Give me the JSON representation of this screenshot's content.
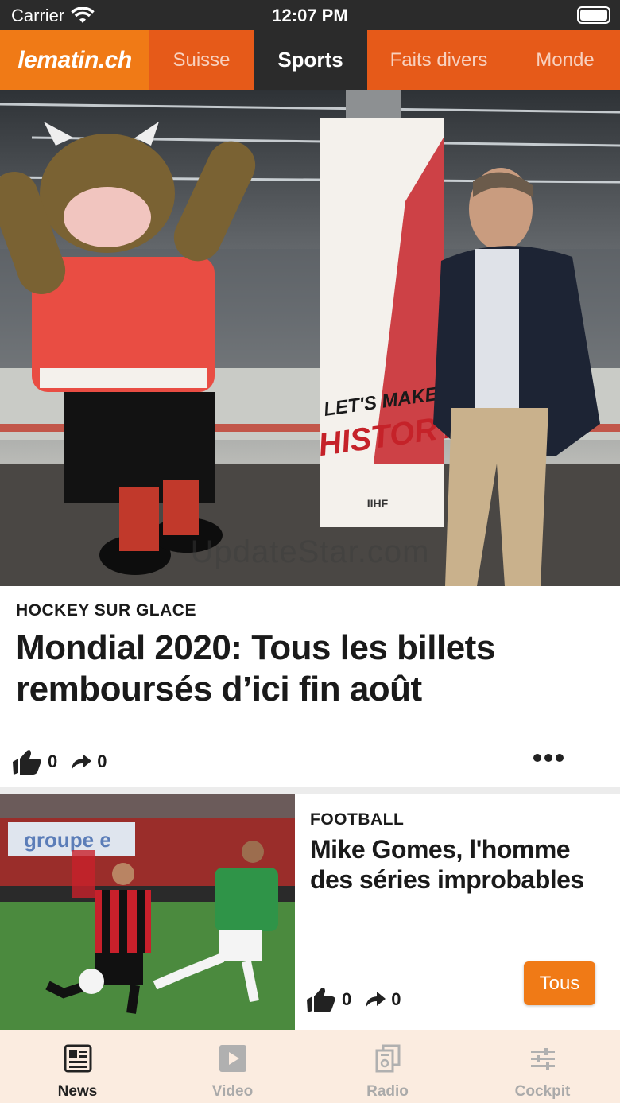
{
  "status_bar": {
    "carrier": "Carrier",
    "time": "12:07 PM"
  },
  "topnav": {
    "logo": "lematin.ch",
    "tabs": [
      {
        "label": "Suisse"
      },
      {
        "label": "Sports",
        "active": true
      },
      {
        "label": "Faits divers"
      },
      {
        "label": "Monde"
      }
    ]
  },
  "hero": {
    "watermark": "UpdateStar.com",
    "banner_text_1": "LET'S MAKE",
    "banner_text_2": "HISTORY",
    "banner_brand": "IIHF"
  },
  "article_1": {
    "kicker": "HOCKEY SUR GLACE",
    "headline": "Mondial 2020: Tous les billets remboursés d’ici fin août",
    "likes": "0",
    "shares": "0"
  },
  "article_2": {
    "kicker": "FOOTBALL",
    "headline": "Mike Gomes, l'homme des séries improbables",
    "likes": "0",
    "shares": "0",
    "thumb_banner": "groupe e"
  },
  "tous_button": "Tous",
  "tabbar": {
    "items": [
      {
        "label": "News",
        "icon": "news-icon",
        "active": true
      },
      {
        "label": "Video",
        "icon": "video-icon"
      },
      {
        "label": "Radio",
        "icon": "radio-icon"
      },
      {
        "label": "Cockpit",
        "icon": "cockpit-icon"
      }
    ]
  },
  "colors": {
    "accent": "#f07a16",
    "nav_bg": "#e65a19",
    "dark": "#2b2b2b",
    "tabbar_bg": "#fbece0"
  }
}
